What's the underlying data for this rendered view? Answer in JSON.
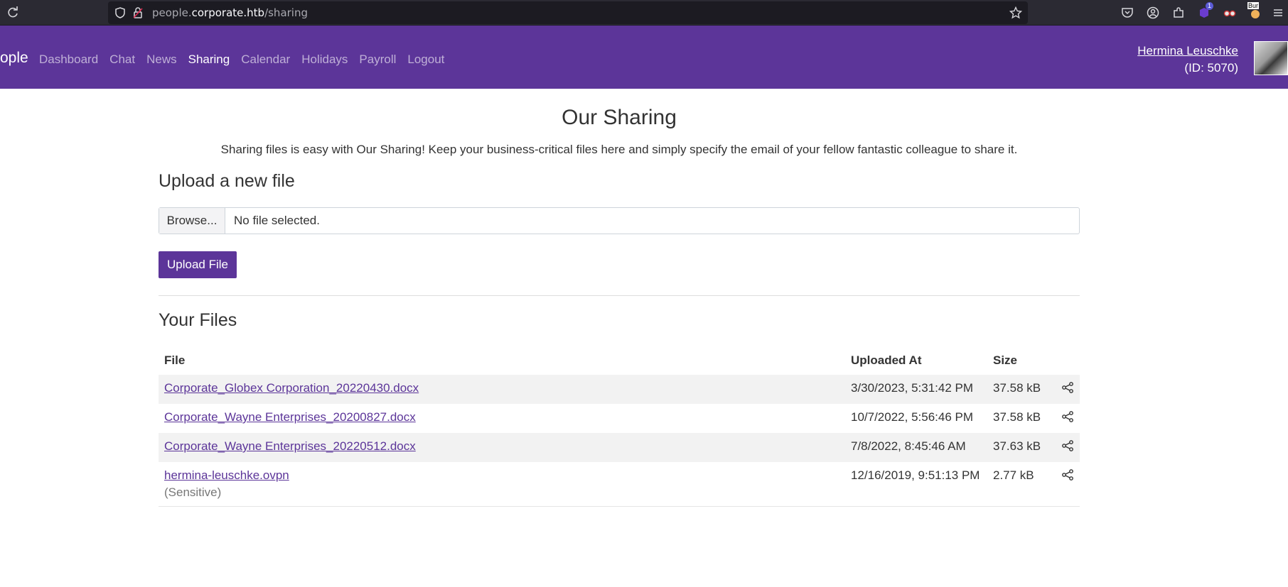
{
  "browser": {
    "url_prefix": "people.",
    "url_host": "corporate.htb",
    "url_path": "/sharing",
    "extension_badge": "1",
    "extension_label": "Bur"
  },
  "nav": {
    "brand": "ople",
    "links": [
      "Dashboard",
      "Chat",
      "News",
      "Sharing",
      "Calendar",
      "Holidays",
      "Payroll",
      "Logout"
    ],
    "active": "Sharing",
    "user_name": "Hermina Leuschke",
    "user_id": "(ID: 5070)"
  },
  "page": {
    "title": "Our Sharing",
    "intro": "Sharing files is easy with Our Sharing! Keep your business-critical files here and simply specify the email of your fellow fantastic colleague to share it.",
    "upload_heading": "Upload a new file",
    "browse_label": "Browse...",
    "file_status": "No file selected.",
    "upload_button": "Upload File",
    "files_heading": "Your Files"
  },
  "table": {
    "headers": [
      "File",
      "Uploaded At",
      "Size"
    ],
    "rows": [
      {
        "file": "Corporate_Globex Corporation_20220430.docx",
        "uploaded": "3/30/2023, 5:31:42 PM",
        "size": "37.58 kB",
        "note": ""
      },
      {
        "file": "Corporate_Wayne Enterprises_20200827.docx",
        "uploaded": "10/7/2022, 5:56:46 PM",
        "size": "37.58 kB",
        "note": ""
      },
      {
        "file": "Corporate_Wayne Enterprises_20220512.docx",
        "uploaded": "7/8/2022, 8:45:46 AM",
        "size": "37.63 kB",
        "note": ""
      },
      {
        "file": "hermina-leuschke.ovpn",
        "uploaded": "12/16/2019, 9:51:13 PM",
        "size": "2.77 kB",
        "note": "(Sensitive)"
      }
    ]
  },
  "colors": {
    "brand": "#5c3599",
    "browser_bg": "#2b2a33"
  }
}
